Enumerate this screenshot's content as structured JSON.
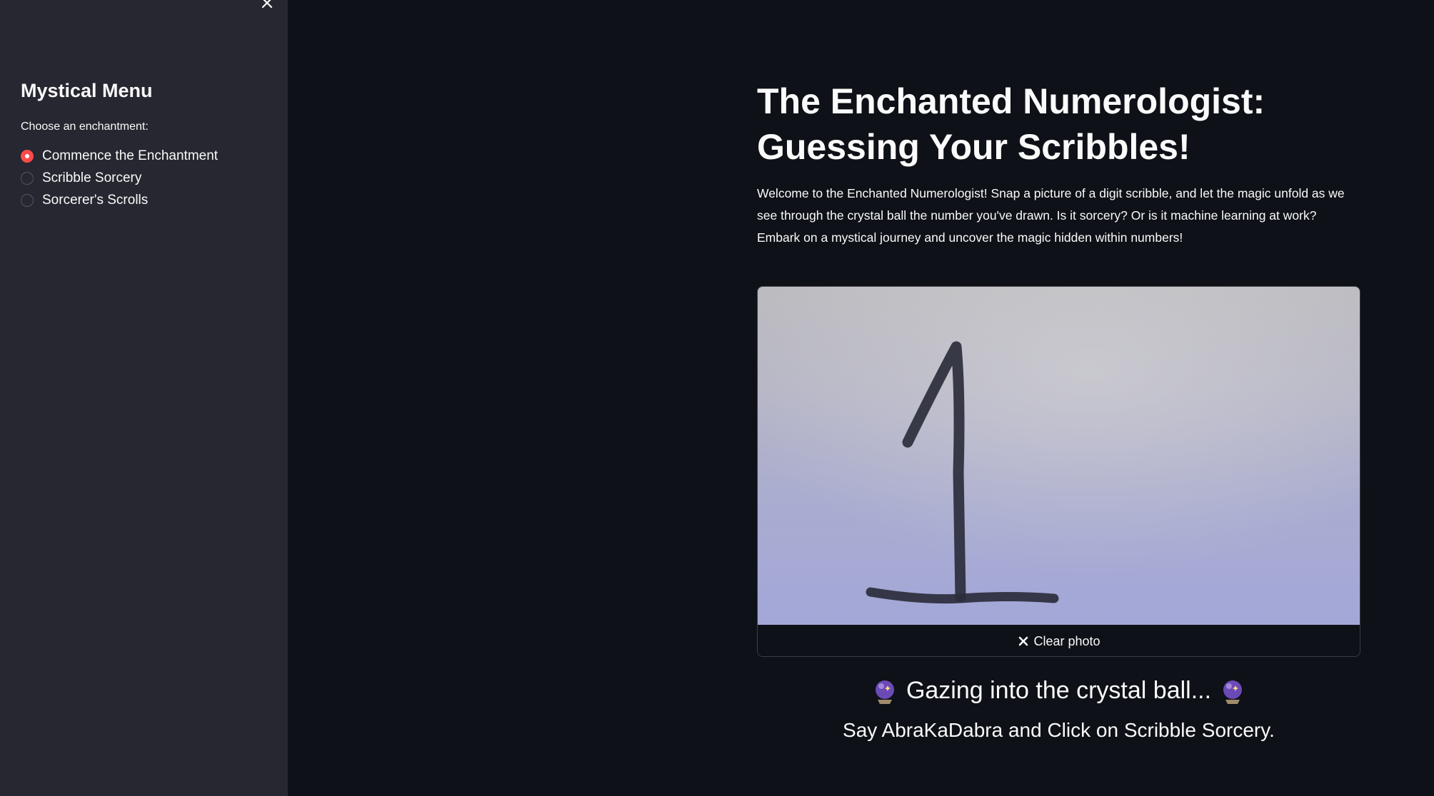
{
  "sidebar": {
    "close_icon": "close-icon",
    "title": "Mystical Menu",
    "radio_label": "Choose an enchantment:",
    "options": [
      {
        "label": "Commence the Enchantment",
        "selected": true
      },
      {
        "label": "Scribble Sorcery",
        "selected": false
      },
      {
        "label": "Sorcerer's Scrolls",
        "selected": false
      }
    ]
  },
  "main": {
    "title": "The Enchanted Numerologist: Guessing Your Scribbles!",
    "intro": "Welcome to the Enchanted Numerologist! Snap a picture of a digit scribble, and let the magic unfold as we see through the crystal ball the number you've drawn. Is it sorcery? Or is it machine learning at work? Embark on a mystical journey and uncover the magic hidden within numbers!",
    "camera": {
      "clear_label": "Clear photo",
      "clear_icon": "close-icon"
    },
    "status": "Gazing into the crystal ball...",
    "status_icon": "crystal-ball-icon",
    "instruction": "Say AbraKaDabra and Click on Scribble Sorcery."
  },
  "colors": {
    "background": "#0e1117",
    "sidebar": "#262730",
    "accent": "#ff4b4b",
    "text": "#fafafa"
  }
}
